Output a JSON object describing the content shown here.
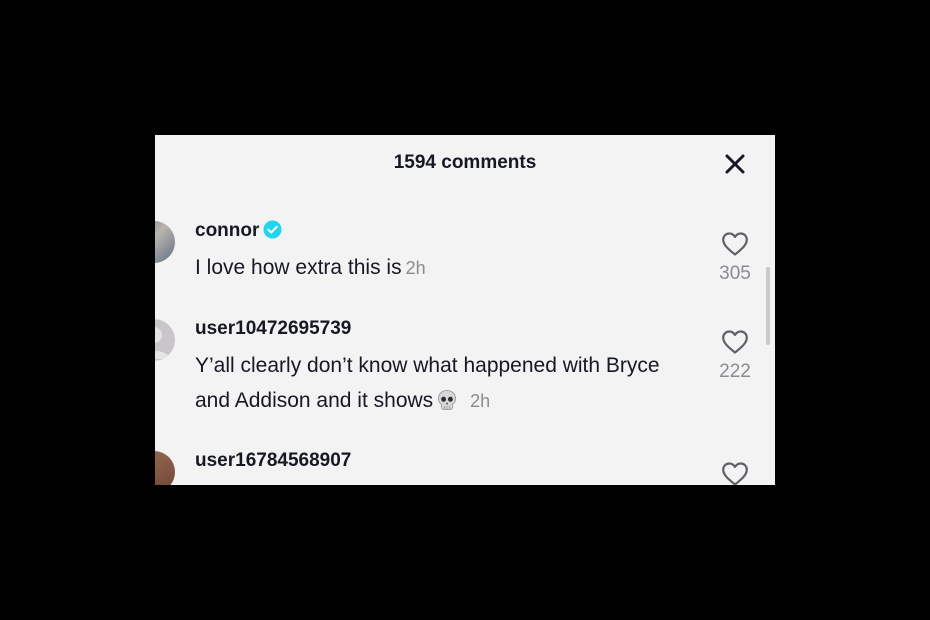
{
  "header": {
    "title": "1594 comments",
    "close_icon": "close-icon"
  },
  "comments": [
    {
      "username": "connor",
      "verified": true,
      "text": "I love how extra this is",
      "time": "2h",
      "likes": "305"
    },
    {
      "username": "user10472695739",
      "verified": false,
      "text": "Y’all clearly don’t know what happened with Bryce and Addison and it shows",
      "emoji": "skull-emoji",
      "time": "2h",
      "likes": "222"
    },
    {
      "username": "user16784568907",
      "verified": false
    }
  ],
  "colors": {
    "sheet_background": "#f4f3f4",
    "text_primary": "#161823",
    "text_secondary": "#8a8b91",
    "verified_badge": "#20d5ec"
  }
}
